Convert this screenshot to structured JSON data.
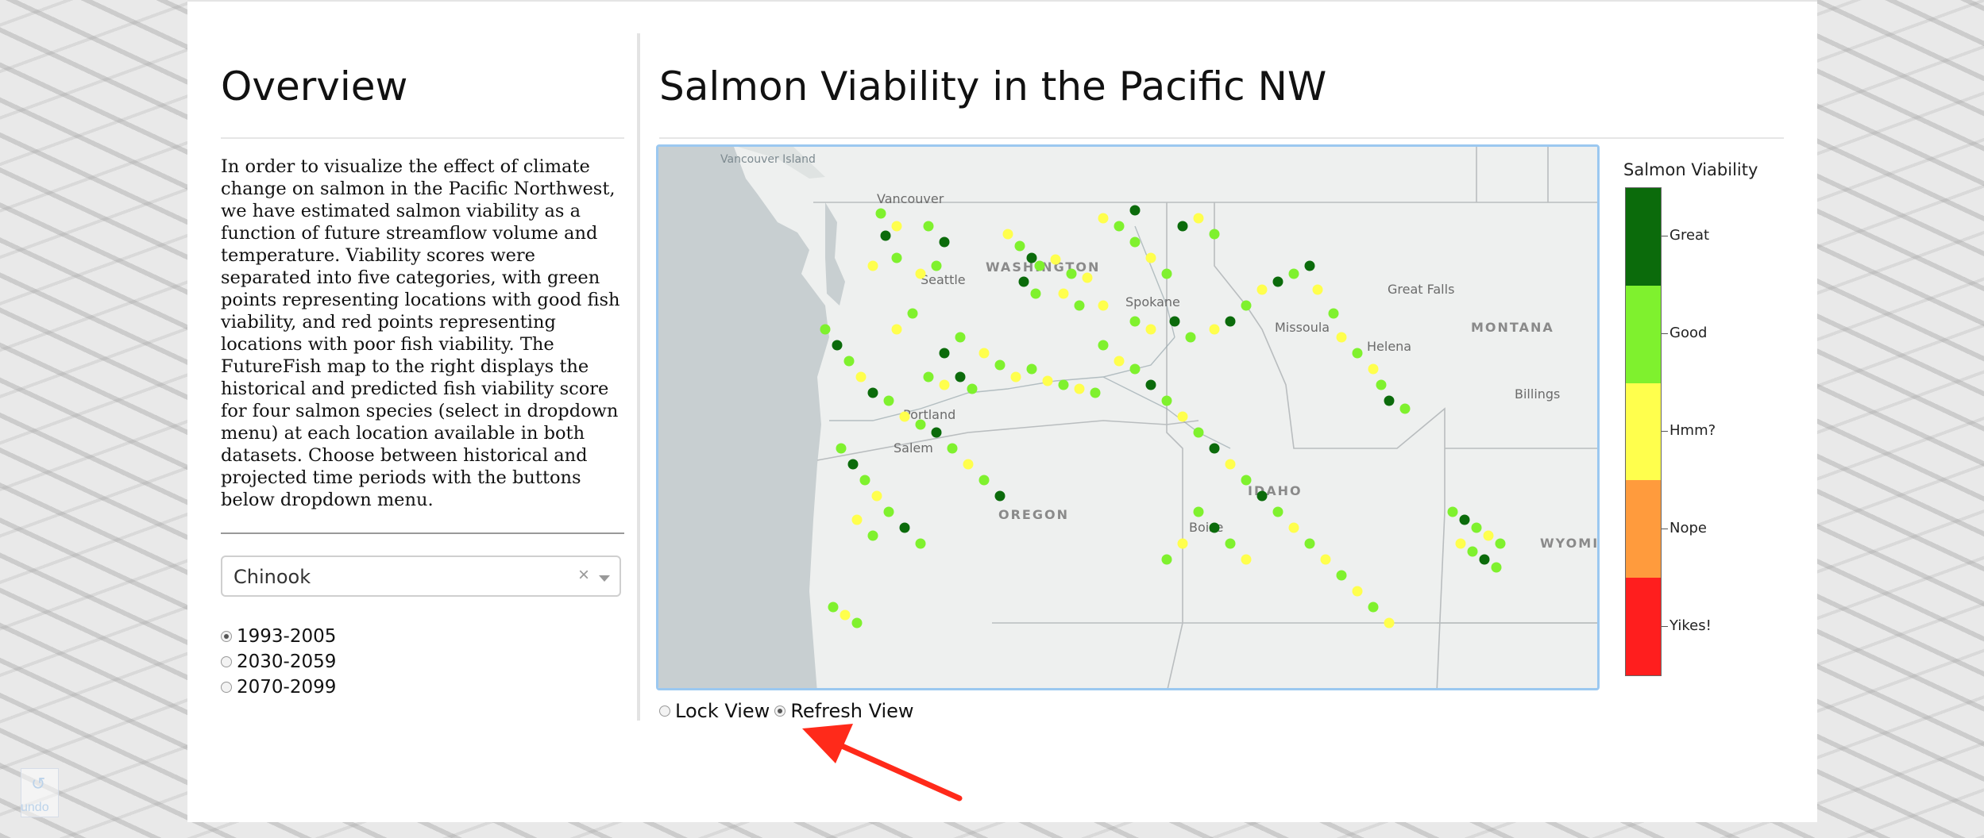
{
  "sidebar": {
    "title": "Overview",
    "description": "In order to visualize the effect of climate change on salmon in the Pacific Northwest, we have estimated salmon viability as a function of future streamflow volume and temperature. Viability scores were separated into five categories, with green points representing locations with good fish viability, and red points representing locations with poor fish viability. The FutureFish map to the right displays the historical and predicted fish viability score for four salmon species (select in dropdown menu) at each location available in both datasets. Choose between historical and projected time periods with the buttons below dropdown menu.",
    "species_dropdown": {
      "value": "Chinook",
      "clear_symbol": "×"
    },
    "periods": [
      {
        "label": "1993-2005",
        "selected": true
      },
      {
        "label": "2030-2059",
        "selected": false
      },
      {
        "label": "2070-2099",
        "selected": false
      }
    ]
  },
  "main": {
    "title": "Salmon Viability in the Pacific NW",
    "map_labels": {
      "vancouver_island": "Vancouver Island",
      "vancouver": "Vancouver",
      "seattle": "Seattle",
      "washington": "WASHINGTON",
      "spokane": "Spokane",
      "missoula": "Missoula",
      "great_falls": "Great Falls",
      "helena": "Helena",
      "montana": "MONTANA",
      "billings": "Billings",
      "portland": "Portland",
      "salem": "Salem",
      "oregon": "OREGON",
      "idaho": "IDAHO",
      "boise": "Boise",
      "wyoming": "WYOMI"
    },
    "view_controls": [
      {
        "label": "Lock View",
        "selected": false
      },
      {
        "label": "Refresh View",
        "selected": true
      }
    ]
  },
  "legend": {
    "title": "Salmon Viability",
    "categories": [
      {
        "label": "Great",
        "color": "#0b6b0b"
      },
      {
        "label": "Good",
        "color": "#7ff12e"
      },
      {
        "label": "Hmm?",
        "color": "#ffff4d"
      },
      {
        "label": "Nope",
        "color": "#ff9b3d"
      },
      {
        "label": "Yikes!",
        "color": "#ff1e1e"
      }
    ]
  },
  "annotation": {
    "arrow_color": "#ff2a1a"
  },
  "undo": {
    "label": "undo",
    "icon": "undo-icon"
  }
}
